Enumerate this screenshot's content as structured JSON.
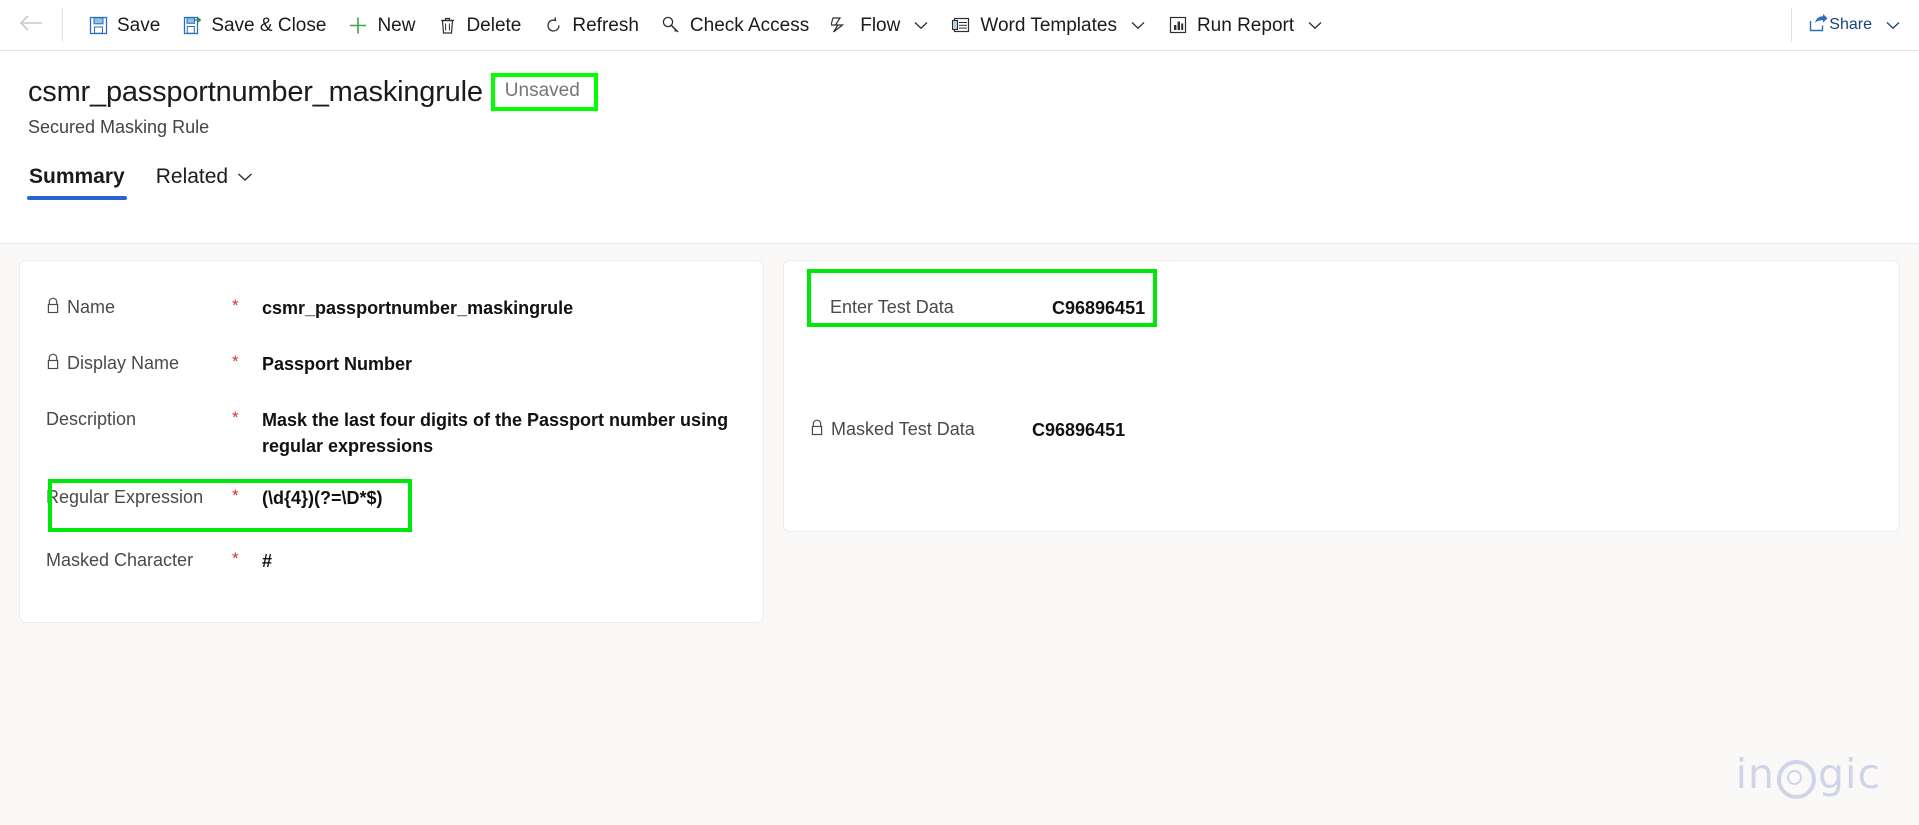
{
  "commandbar": {
    "back_icon": "back-arrow-icon",
    "buttons": [
      {
        "label": "Save",
        "icon": "save-floppy-icon",
        "has_chevron": false
      },
      {
        "label": "Save & Close",
        "icon": "save-and-close-icon",
        "has_chevron": false
      },
      {
        "label": "New",
        "icon": "plus-icon",
        "has_chevron": false
      },
      {
        "label": "Delete",
        "icon": "trash-icon",
        "has_chevron": false
      },
      {
        "label": "Refresh",
        "icon": "refresh-icon",
        "has_chevron": false
      },
      {
        "label": "Check Access",
        "icon": "key-icon",
        "has_chevron": false
      },
      {
        "label": "Flow",
        "icon": "flow-icon",
        "has_chevron": true
      },
      {
        "label": "Word Templates",
        "icon": "word-template-icon",
        "has_chevron": true
      },
      {
        "label": "Run Report",
        "icon": "run-report-icon",
        "has_chevron": true
      }
    ],
    "share": {
      "label": "Share",
      "icon": "share-icon",
      "has_chevron": true
    }
  },
  "header": {
    "title": "csmr_passportnumber_maskingrule",
    "status_badge": "Unsaved",
    "entity_name": "Secured Masking Rule"
  },
  "tabs": [
    {
      "label": "Summary",
      "active": true,
      "has_chevron": false
    },
    {
      "label": "Related",
      "active": false,
      "has_chevron": true
    }
  ],
  "left_card": {
    "fields": [
      {
        "label": "Name",
        "locked": true,
        "required": "*",
        "value": "csmr_passportnumber_maskingrule",
        "bold": true
      },
      {
        "label": "Display Name",
        "locked": true,
        "required": "*",
        "value": "Passport Number",
        "bold": true
      },
      {
        "label": "Description",
        "locked": false,
        "required": "*",
        "value": "Mask the last four digits of the Passport number using regular expressions",
        "bold": true
      },
      {
        "label": "Regular Expression",
        "locked": false,
        "required": "*",
        "value": "(\\d{4})(?=\\D*$)",
        "bold": true,
        "highlighted": true
      },
      {
        "label": "Masked Character",
        "locked": false,
        "required": "*",
        "value": "#",
        "bold": true
      }
    ]
  },
  "right_card": {
    "fields": [
      {
        "label": "Enter Test Data",
        "locked": false,
        "required": "",
        "value": "C96896451",
        "bold": true,
        "highlighted": true
      },
      {
        "label": "Masked Test Data",
        "locked": true,
        "required": "",
        "value": "C96896451",
        "bold": true
      }
    ]
  },
  "watermark": {
    "text_before": "in",
    "text_after": "gic"
  },
  "colors": {
    "accent_tab_underline": "#2a64d4",
    "annotation_green": "#00e80a",
    "required_red": "#d13438",
    "share_blue": "#16427f",
    "canvas_bg": "#faf9f8",
    "watermark": "#ced3e8"
  }
}
